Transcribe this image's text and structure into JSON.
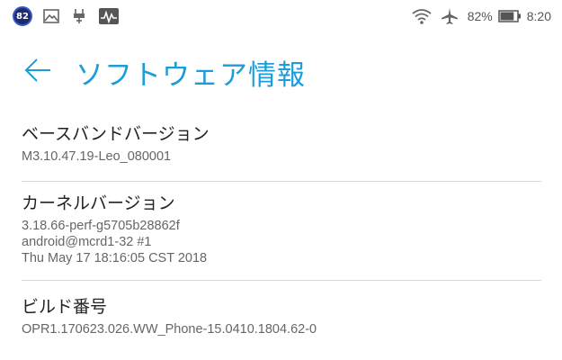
{
  "status_bar": {
    "notification_badge": "82",
    "icons_left": [
      "image-icon",
      "usb-debug-icon",
      "activity-icon"
    ],
    "icons_right": [
      "wifi-icon",
      "airplane-mode-icon",
      "battery-icon"
    ],
    "battery_percent": "82%",
    "battery_level": 0.82,
    "time": "8:20"
  },
  "header": {
    "title": "ソフトウェア情報",
    "accent_color": "#1b9dd9"
  },
  "sections": [
    {
      "title": "ベースバンドバージョン",
      "lines": [
        "M3.10.47.19-Leo_080001"
      ]
    },
    {
      "title": "カーネルバージョン",
      "lines": [
        "3.18.66-perf-g5705b28862f",
        "android@mcrd1-32 #1",
        "Thu May 17 18:16:05 CST 2018"
      ]
    },
    {
      "title": "ビルド番号",
      "lines": [
        "OPR1.170623.026.WW_Phone-15.0410.1804.62-0"
      ]
    }
  ]
}
